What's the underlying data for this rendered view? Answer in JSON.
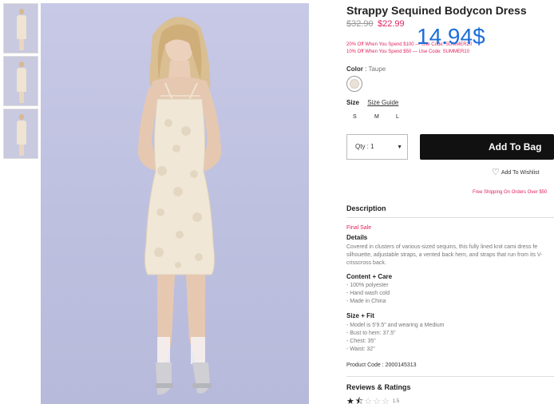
{
  "thumbnails": [
    {
      "name": "thumbnail-front"
    },
    {
      "name": "thumbnail-side"
    },
    {
      "name": "thumbnail-back"
    }
  ],
  "product": {
    "title": "Strappy Sequined Bodycon Dress",
    "original_price": "$32.90",
    "sale_price": "$22.99",
    "overlay_price": "14.94$",
    "promo_1": "20% Off When You Spend $100 — Use Code: SUMMER20",
    "promo_2": "10% Off When You Spend $50 — Use Code: SUMMER10",
    "color_label": "Color",
    "color_value": "Taupe",
    "swatch_color": "#e9e2d6",
    "size_label": "Size",
    "size_guide": "Size Guide",
    "sizes": [
      "S",
      "M",
      "L"
    ],
    "qty_label": "Qty : 1",
    "add_to_bag": "Add To Bag",
    "wishlist": "Add To Wishlist",
    "free_shipping": "Free Shipping On Orders Over $50"
  },
  "description": {
    "heading": "Description",
    "final_sale": "Final Sale",
    "details_heading": "Details",
    "details_lines": [
      "Covered in clusters of various-sized sequins, this fully lined knit cami dress fe",
      "silhouette, adjustable straps, a vented back hem, and straps that run from its V-",
      "crisscross back."
    ],
    "content_heading": "Content + Care",
    "content_lines": [
      "- 100% polyester",
      "- Hand wash cold",
      "- Made in China"
    ],
    "fit_heading": "Size + Fit",
    "fit_lines": [
      "- Model is 5'9.5\" and wearing a Medium",
      "- Bust to hem: 37.5\"",
      "- Chest: 35\"",
      "- Waist: 32\""
    ],
    "product_code": "Product Code : 2000145313"
  },
  "reviews": {
    "heading": "Reviews & Ratings",
    "rating": 1.5,
    "max_rating": 5,
    "count": "1.5"
  },
  "colors": {
    "accent_pink": "#e0245e",
    "overlay_blue": "#1e6fd9",
    "button_black": "#111111",
    "backdrop_lavender": "#c7c9e6"
  }
}
